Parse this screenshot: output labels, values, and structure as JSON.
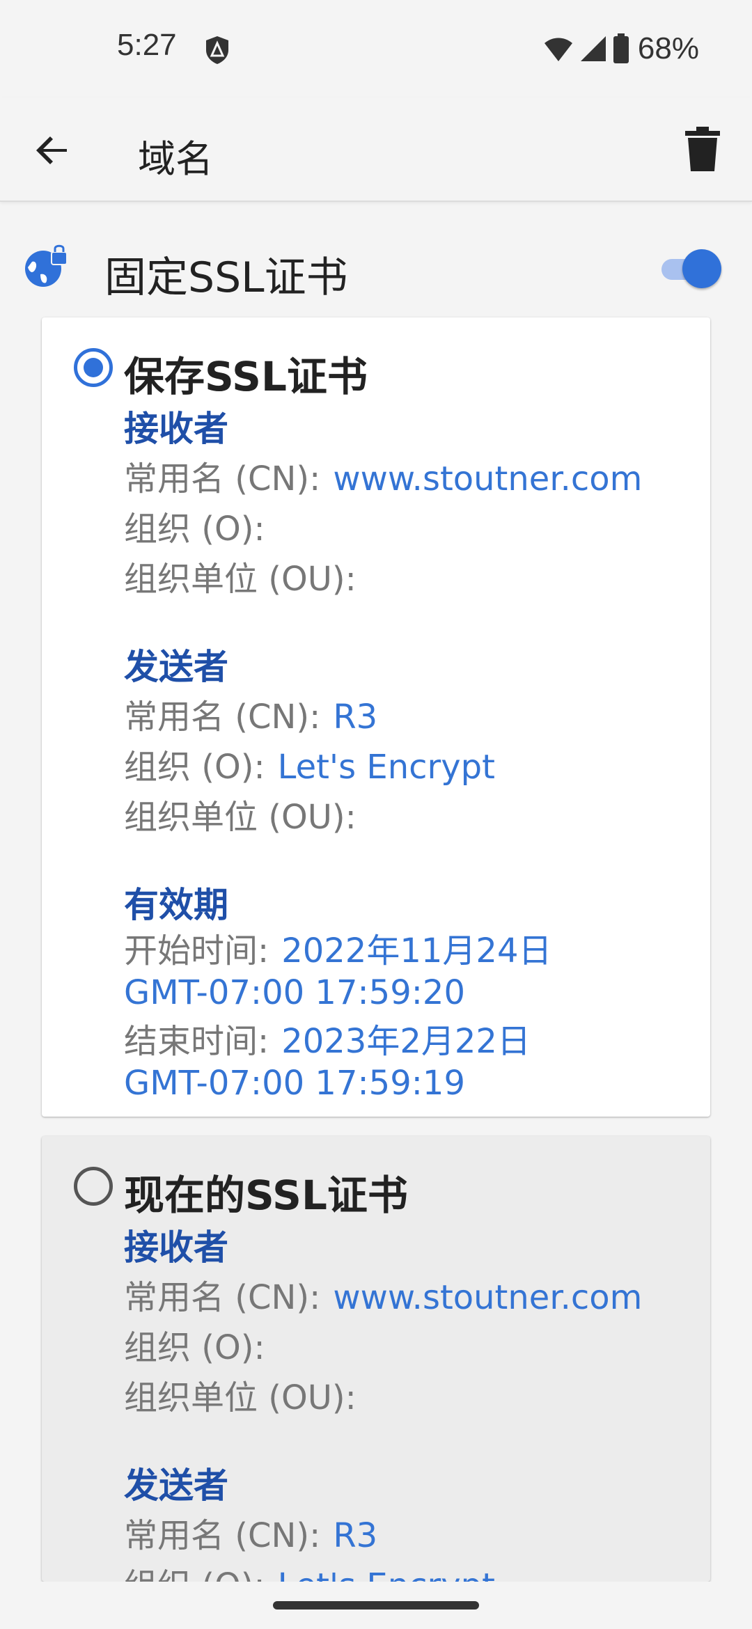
{
  "status_bar": {
    "time": "5:27",
    "battery": "68%",
    "icons": [
      "shield-icon",
      "wifi-icon",
      "signal-icon",
      "battery-icon"
    ]
  },
  "app_bar": {
    "title": "域名",
    "back_icon": "arrow-back-icon",
    "delete_icon": "trash-icon"
  },
  "pin_ssl": {
    "label": "固定SSL证书",
    "enabled": true,
    "icon": "globe-lock-icon"
  },
  "colors": {
    "accent": "#3071d9",
    "section_heading": "#1f4fa8",
    "value_text": "#3474d4",
    "label_text": "#777777"
  },
  "saved_cert": {
    "title": "保存SSL证书",
    "selected": true,
    "issued_to": {
      "heading": "接收者",
      "cn_label": "常用名 (CN):",
      "cn_value": "www.stoutner.com",
      "o_label": "组织 (O):",
      "o_value": "",
      "ou_label": "组织单位 (OU):",
      "ou_value": ""
    },
    "issued_by": {
      "heading": "发送者",
      "cn_label": "常用名 (CN):",
      "cn_value": "R3",
      "o_label": "组织 (O):",
      "o_value": "Let's Encrypt",
      "ou_label": "组织单位 (OU):",
      "ou_value": ""
    },
    "validity": {
      "heading": "有效期",
      "start_label": "开始时间:",
      "start_date": "2022年11月24日",
      "start_time": "GMT-07:00 17:59:20",
      "end_label": "结束时间:",
      "end_date": "2023年2月22日",
      "end_time": "GMT-07:00 17:59:19"
    }
  },
  "current_cert": {
    "title": "现在的SSL证书",
    "selected": false,
    "issued_to": {
      "heading": "接收者",
      "cn_label": "常用名 (CN):",
      "cn_value": "www.stoutner.com",
      "o_label": "组织 (O):",
      "o_value": "",
      "ou_label": "组织单位 (OU):",
      "ou_value": ""
    },
    "issued_by": {
      "heading": "发送者",
      "cn_label": "常用名 (CN):",
      "cn_value": "R3",
      "o_label": "组织 (O):",
      "o_value": "Let's Encrypt"
    }
  }
}
